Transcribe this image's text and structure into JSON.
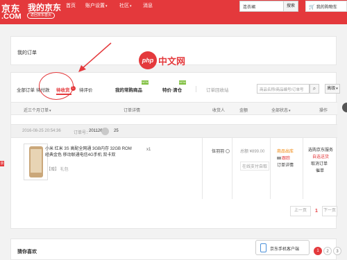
{
  "header": {
    "logo_main": "京东",
    "logo_com": ".COM",
    "page_title": "我的京东",
    "back_home": "返回京东首页",
    "nav": {
      "home": "首页",
      "account_settings": "账户设置",
      "community": "社区",
      "messages": "消息"
    },
    "search_value": "连衣裙",
    "search_button": "搜索",
    "cart_label": "我的购物车"
  },
  "left_marker": "京",
  "panels": {
    "my_orders_title": "我的订单",
    "guess_title": "猜你喜欢"
  },
  "tabs": {
    "all": "全部订单",
    "pending_pay": "待付款",
    "pending_receive": "待收货",
    "pending_receive_badge": "1",
    "pending_eval": "待评价",
    "common_products": "我的常购商品",
    "special_clear": "特价·清仓",
    "new_tag": "NEW",
    "recycle": "订单回收站"
  },
  "order_search": {
    "placeholder": "商品名称/商品编号/订单号",
    "advanced": "高级"
  },
  "table_header": {
    "range": "近三个月订单",
    "detail": "订单详情",
    "receiver": "收货人",
    "amount": "金额",
    "status": "全部状态",
    "operation": "操作"
  },
  "order": {
    "date": "2016-08-25 20:54:36",
    "number_label": "订单号：",
    "number_head": "201126",
    "number_tail": "25",
    "product_name": "小米 红米 3S 高配全网通 3GB内存 32GB ROM 经典金色 移动联通电信4G手机 双卡双",
    "gift": "【赠】 礼包",
    "quantity": "x1",
    "receiver": "伍羽羽",
    "amount": "总额 ¥899.00",
    "pay_method": "在线支付自取",
    "status_out": "商品出库",
    "status_track": "跟踪",
    "status_detail": "订单详情",
    "op_contact": "选购京东服务",
    "op_remind": "自选送货",
    "op_cancel": "取消订单",
    "op_receipt": "催单"
  },
  "watermark": {
    "php_logo": "php",
    "php_text": "中文网"
  },
  "pager": {
    "prev": "上一页",
    "current": "1",
    "next": "下一页"
  },
  "phone_badge": "京东手机客户端",
  "guess_pages": [
    "1",
    "2",
    "3"
  ]
}
